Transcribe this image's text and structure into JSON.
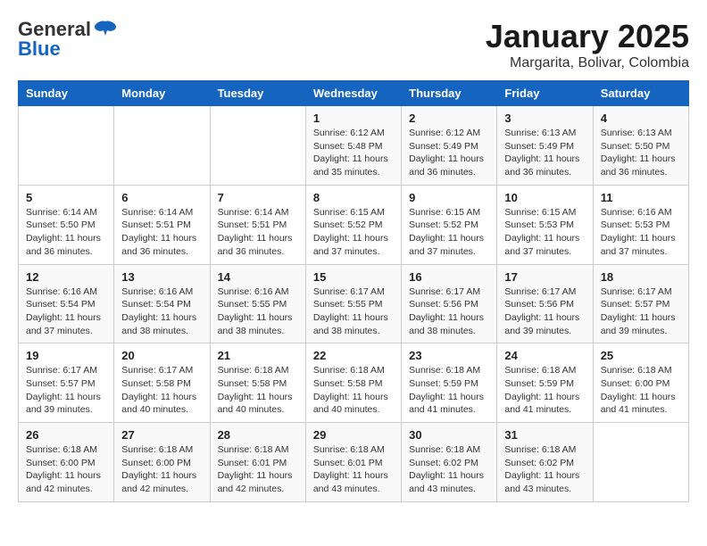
{
  "header": {
    "logo_general": "General",
    "logo_blue": "Blue",
    "month": "January 2025",
    "location": "Margarita, Bolivar, Colombia"
  },
  "days_of_week": [
    "Sunday",
    "Monday",
    "Tuesday",
    "Wednesday",
    "Thursday",
    "Friday",
    "Saturday"
  ],
  "weeks": [
    [
      {
        "day": "",
        "info": ""
      },
      {
        "day": "",
        "info": ""
      },
      {
        "day": "",
        "info": ""
      },
      {
        "day": "1",
        "info": "Sunrise: 6:12 AM\nSunset: 5:48 PM\nDaylight: 11 hours\nand 35 minutes."
      },
      {
        "day": "2",
        "info": "Sunrise: 6:12 AM\nSunset: 5:49 PM\nDaylight: 11 hours\nand 36 minutes."
      },
      {
        "day": "3",
        "info": "Sunrise: 6:13 AM\nSunset: 5:49 PM\nDaylight: 11 hours\nand 36 minutes."
      },
      {
        "day": "4",
        "info": "Sunrise: 6:13 AM\nSunset: 5:50 PM\nDaylight: 11 hours\nand 36 minutes."
      }
    ],
    [
      {
        "day": "5",
        "info": "Sunrise: 6:14 AM\nSunset: 5:50 PM\nDaylight: 11 hours\nand 36 minutes."
      },
      {
        "day": "6",
        "info": "Sunrise: 6:14 AM\nSunset: 5:51 PM\nDaylight: 11 hours\nand 36 minutes."
      },
      {
        "day": "7",
        "info": "Sunrise: 6:14 AM\nSunset: 5:51 PM\nDaylight: 11 hours\nand 36 minutes."
      },
      {
        "day": "8",
        "info": "Sunrise: 6:15 AM\nSunset: 5:52 PM\nDaylight: 11 hours\nand 37 minutes."
      },
      {
        "day": "9",
        "info": "Sunrise: 6:15 AM\nSunset: 5:52 PM\nDaylight: 11 hours\nand 37 minutes."
      },
      {
        "day": "10",
        "info": "Sunrise: 6:15 AM\nSunset: 5:53 PM\nDaylight: 11 hours\nand 37 minutes."
      },
      {
        "day": "11",
        "info": "Sunrise: 6:16 AM\nSunset: 5:53 PM\nDaylight: 11 hours\nand 37 minutes."
      }
    ],
    [
      {
        "day": "12",
        "info": "Sunrise: 6:16 AM\nSunset: 5:54 PM\nDaylight: 11 hours\nand 37 minutes."
      },
      {
        "day": "13",
        "info": "Sunrise: 6:16 AM\nSunset: 5:54 PM\nDaylight: 11 hours\nand 38 minutes."
      },
      {
        "day": "14",
        "info": "Sunrise: 6:16 AM\nSunset: 5:55 PM\nDaylight: 11 hours\nand 38 minutes."
      },
      {
        "day": "15",
        "info": "Sunrise: 6:17 AM\nSunset: 5:55 PM\nDaylight: 11 hours\nand 38 minutes."
      },
      {
        "day": "16",
        "info": "Sunrise: 6:17 AM\nSunset: 5:56 PM\nDaylight: 11 hours\nand 38 minutes."
      },
      {
        "day": "17",
        "info": "Sunrise: 6:17 AM\nSunset: 5:56 PM\nDaylight: 11 hours\nand 39 minutes."
      },
      {
        "day": "18",
        "info": "Sunrise: 6:17 AM\nSunset: 5:57 PM\nDaylight: 11 hours\nand 39 minutes."
      }
    ],
    [
      {
        "day": "19",
        "info": "Sunrise: 6:17 AM\nSunset: 5:57 PM\nDaylight: 11 hours\nand 39 minutes."
      },
      {
        "day": "20",
        "info": "Sunrise: 6:17 AM\nSunset: 5:58 PM\nDaylight: 11 hours\nand 40 minutes."
      },
      {
        "day": "21",
        "info": "Sunrise: 6:18 AM\nSunset: 5:58 PM\nDaylight: 11 hours\nand 40 minutes."
      },
      {
        "day": "22",
        "info": "Sunrise: 6:18 AM\nSunset: 5:58 PM\nDaylight: 11 hours\nand 40 minutes."
      },
      {
        "day": "23",
        "info": "Sunrise: 6:18 AM\nSunset: 5:59 PM\nDaylight: 11 hours\nand 41 minutes."
      },
      {
        "day": "24",
        "info": "Sunrise: 6:18 AM\nSunset: 5:59 PM\nDaylight: 11 hours\nand 41 minutes."
      },
      {
        "day": "25",
        "info": "Sunrise: 6:18 AM\nSunset: 6:00 PM\nDaylight: 11 hours\nand 41 minutes."
      }
    ],
    [
      {
        "day": "26",
        "info": "Sunrise: 6:18 AM\nSunset: 6:00 PM\nDaylight: 11 hours\nand 42 minutes."
      },
      {
        "day": "27",
        "info": "Sunrise: 6:18 AM\nSunset: 6:00 PM\nDaylight: 11 hours\nand 42 minutes."
      },
      {
        "day": "28",
        "info": "Sunrise: 6:18 AM\nSunset: 6:01 PM\nDaylight: 11 hours\nand 42 minutes."
      },
      {
        "day": "29",
        "info": "Sunrise: 6:18 AM\nSunset: 6:01 PM\nDaylight: 11 hours\nand 43 minutes."
      },
      {
        "day": "30",
        "info": "Sunrise: 6:18 AM\nSunset: 6:02 PM\nDaylight: 11 hours\nand 43 minutes."
      },
      {
        "day": "31",
        "info": "Sunrise: 6:18 AM\nSunset: 6:02 PM\nDaylight: 11 hours\nand 43 minutes."
      },
      {
        "day": "",
        "info": ""
      }
    ]
  ]
}
